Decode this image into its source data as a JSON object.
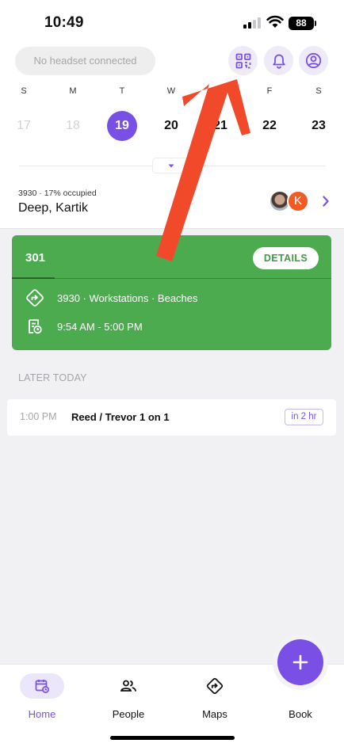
{
  "status_bar": {
    "time": "10:49",
    "battery": "88"
  },
  "header": {
    "headset_status": "No headset connected",
    "icons": [
      "qr-code-icon",
      "bell-icon",
      "profile-icon"
    ]
  },
  "calendar": {
    "weekdays": [
      "S",
      "M",
      "T",
      "W",
      "T",
      "F",
      "S"
    ],
    "days": [
      {
        "num": "17",
        "state": "past"
      },
      {
        "num": "18",
        "state": "past"
      },
      {
        "num": "19",
        "state": "selected"
      },
      {
        "num": "20",
        "state": "normal"
      },
      {
        "num": "21",
        "state": "normal"
      },
      {
        "num": "22",
        "state": "normal"
      },
      {
        "num": "23",
        "state": "normal"
      }
    ]
  },
  "location": {
    "building": "3930",
    "occupancy": "· 17% occupied",
    "user_name": "Deep, Kartik",
    "avatar_initial": "K"
  },
  "booking": {
    "room": "301",
    "details_label": "DETAILS",
    "location_line": "3930    · Workstations · Beaches",
    "time_range": "9:54 AM - 5:00 PM",
    "color": "#4caa4f"
  },
  "later_today": {
    "heading": "LATER TODAY",
    "events": [
      {
        "time": "1:00 PM",
        "title": "Reed / Trevor 1 on 1",
        "badge": "in 2 hr"
      }
    ]
  },
  "bottom_nav": {
    "items": [
      {
        "label": "Home",
        "icon": "calendar-icon",
        "active": true
      },
      {
        "label": "People",
        "icon": "people-icon",
        "active": false
      },
      {
        "label": "Maps",
        "icon": "directions-icon",
        "active": false
      },
      {
        "label": "Book",
        "icon": "plus-icon",
        "active": false
      }
    ]
  },
  "colors": {
    "accent": "#7a4fe6",
    "annotation_arrow": "#f04a2a"
  }
}
